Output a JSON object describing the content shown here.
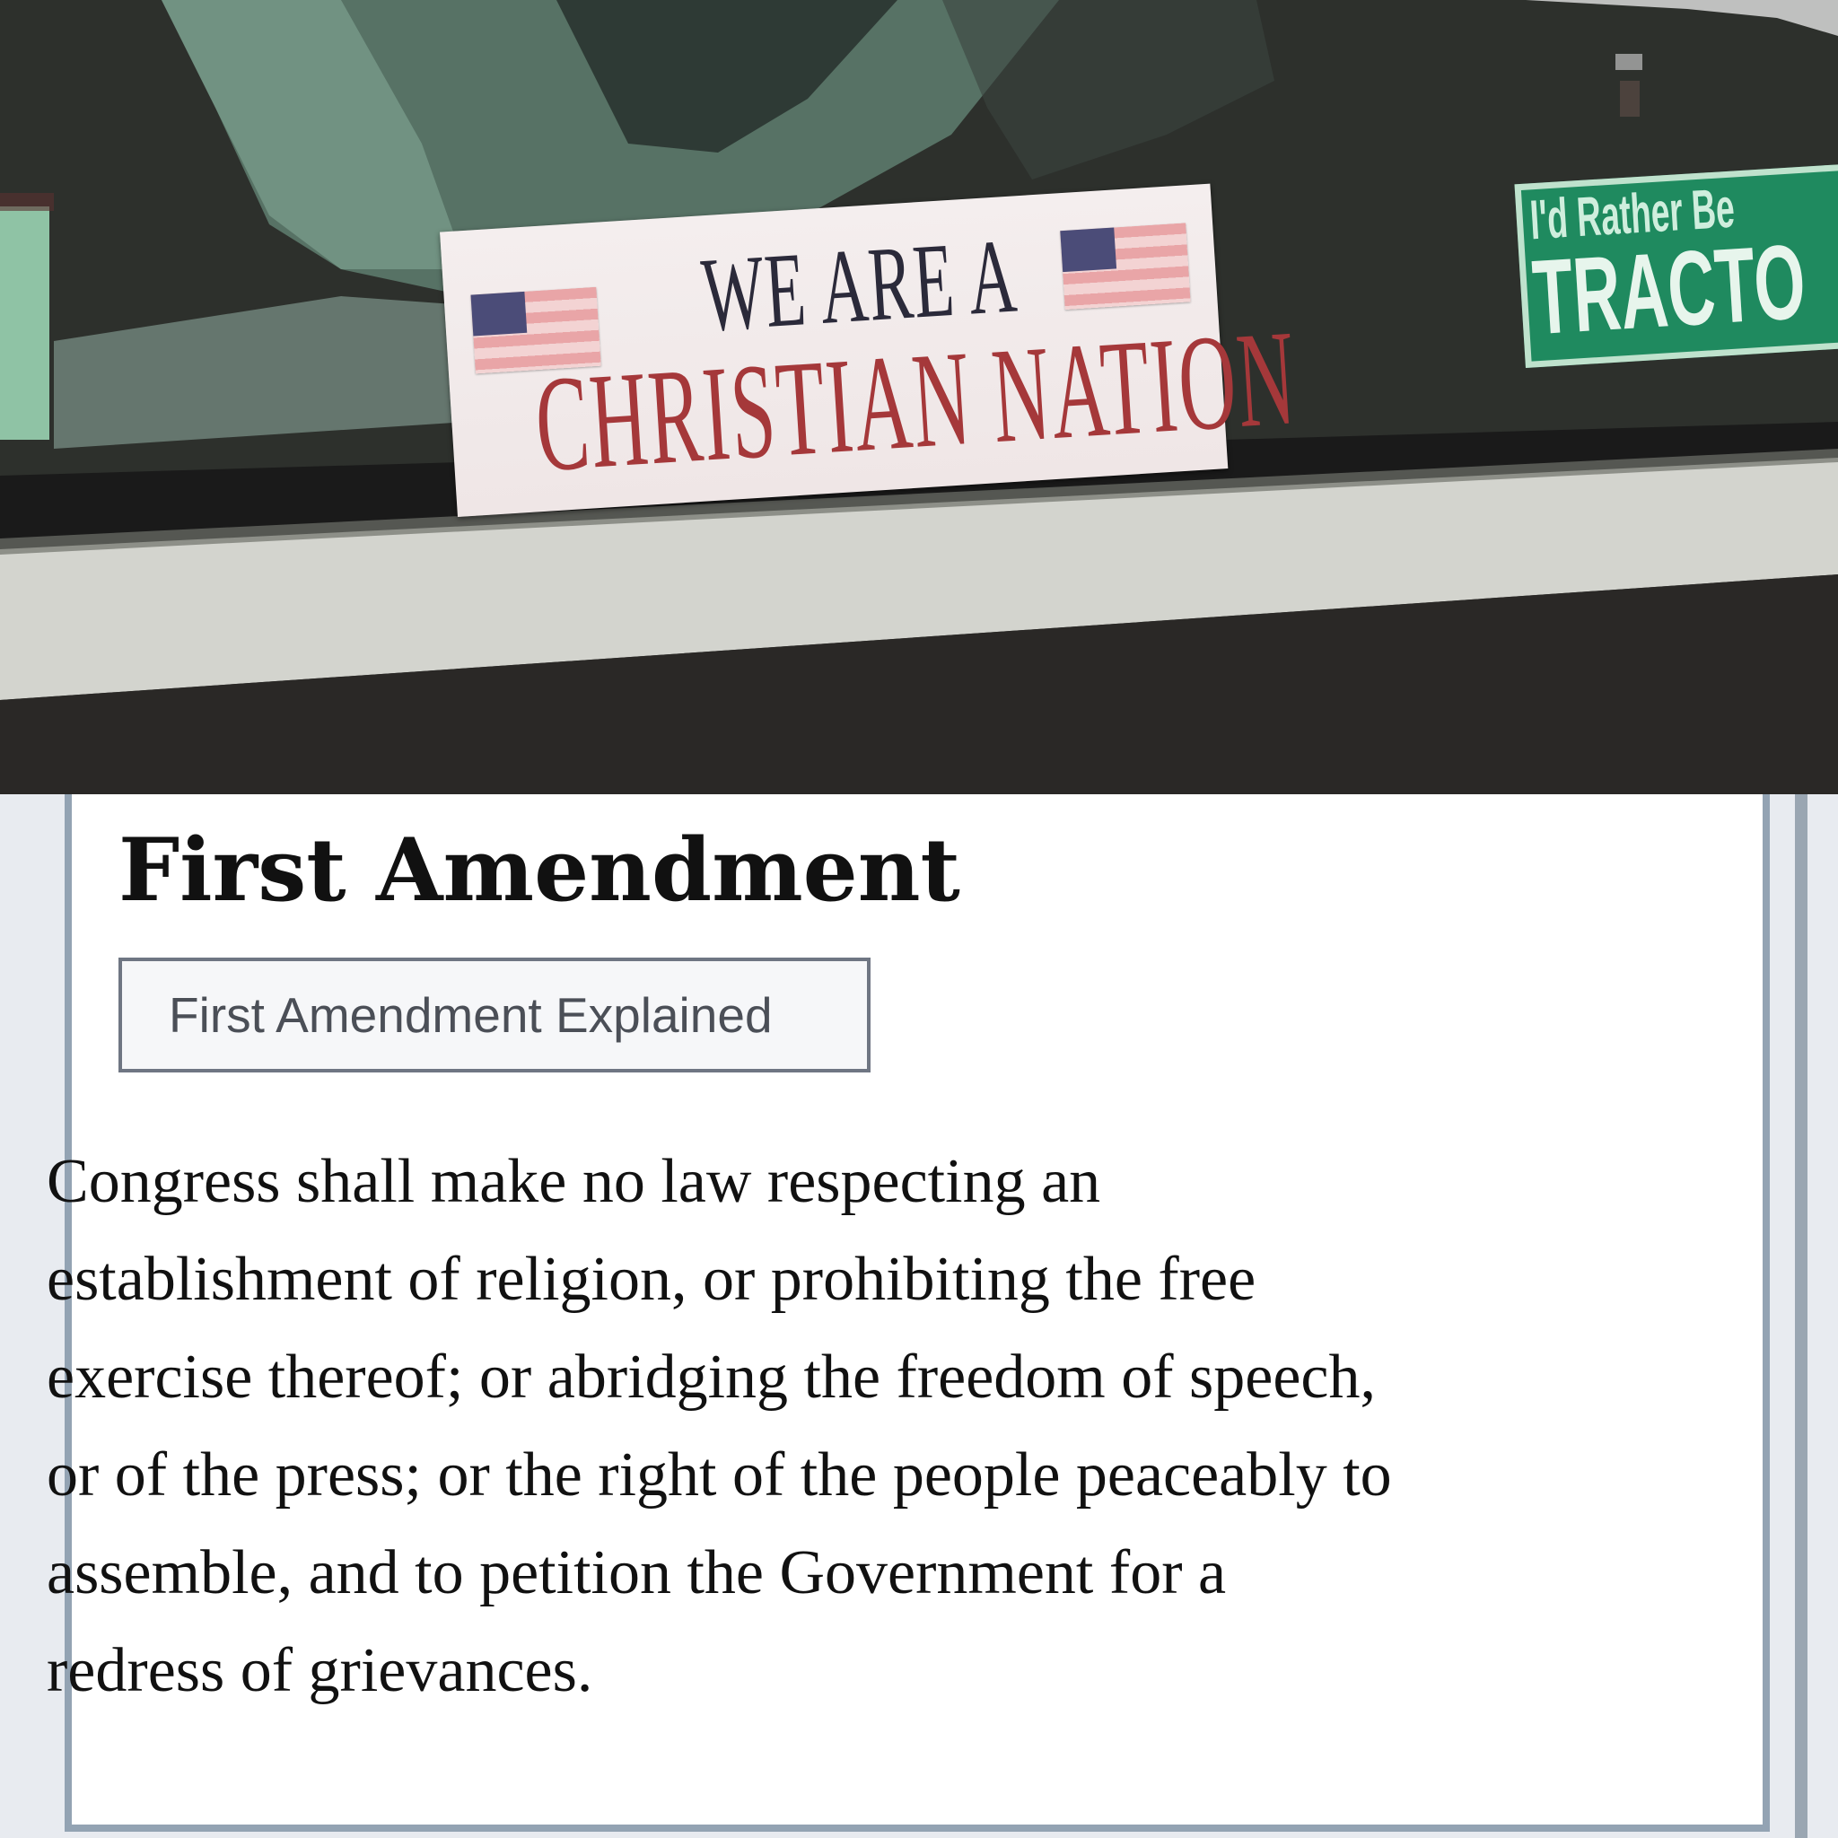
{
  "photo": {
    "main_sticker": {
      "line1": "WE ARE A",
      "line2": "CHRISTIAN NATION"
    },
    "green_sticker": {
      "small_text": "I'd Rather Be",
      "big_text": "TRACTO"
    }
  },
  "article": {
    "title": "First Amendment",
    "explain_button_label": "First Amendment Explained",
    "text_lines": [
      "Congress shall make no law respecting an",
      "establishment of religion, or prohibiting the free",
      "exercise thereof; or abridging the freedom of speech,",
      "or of the press; or the right of the people peaceably to",
      "assemble, and to petition the Government for a",
      "redress of grievances."
    ]
  },
  "colors": {
    "sticker_red": "#a5383a",
    "sticker_navy": "#2b2a3a",
    "green_sticker": "#1f8a5f",
    "card_border": "#93a3b3",
    "button_border": "#6f7683"
  }
}
